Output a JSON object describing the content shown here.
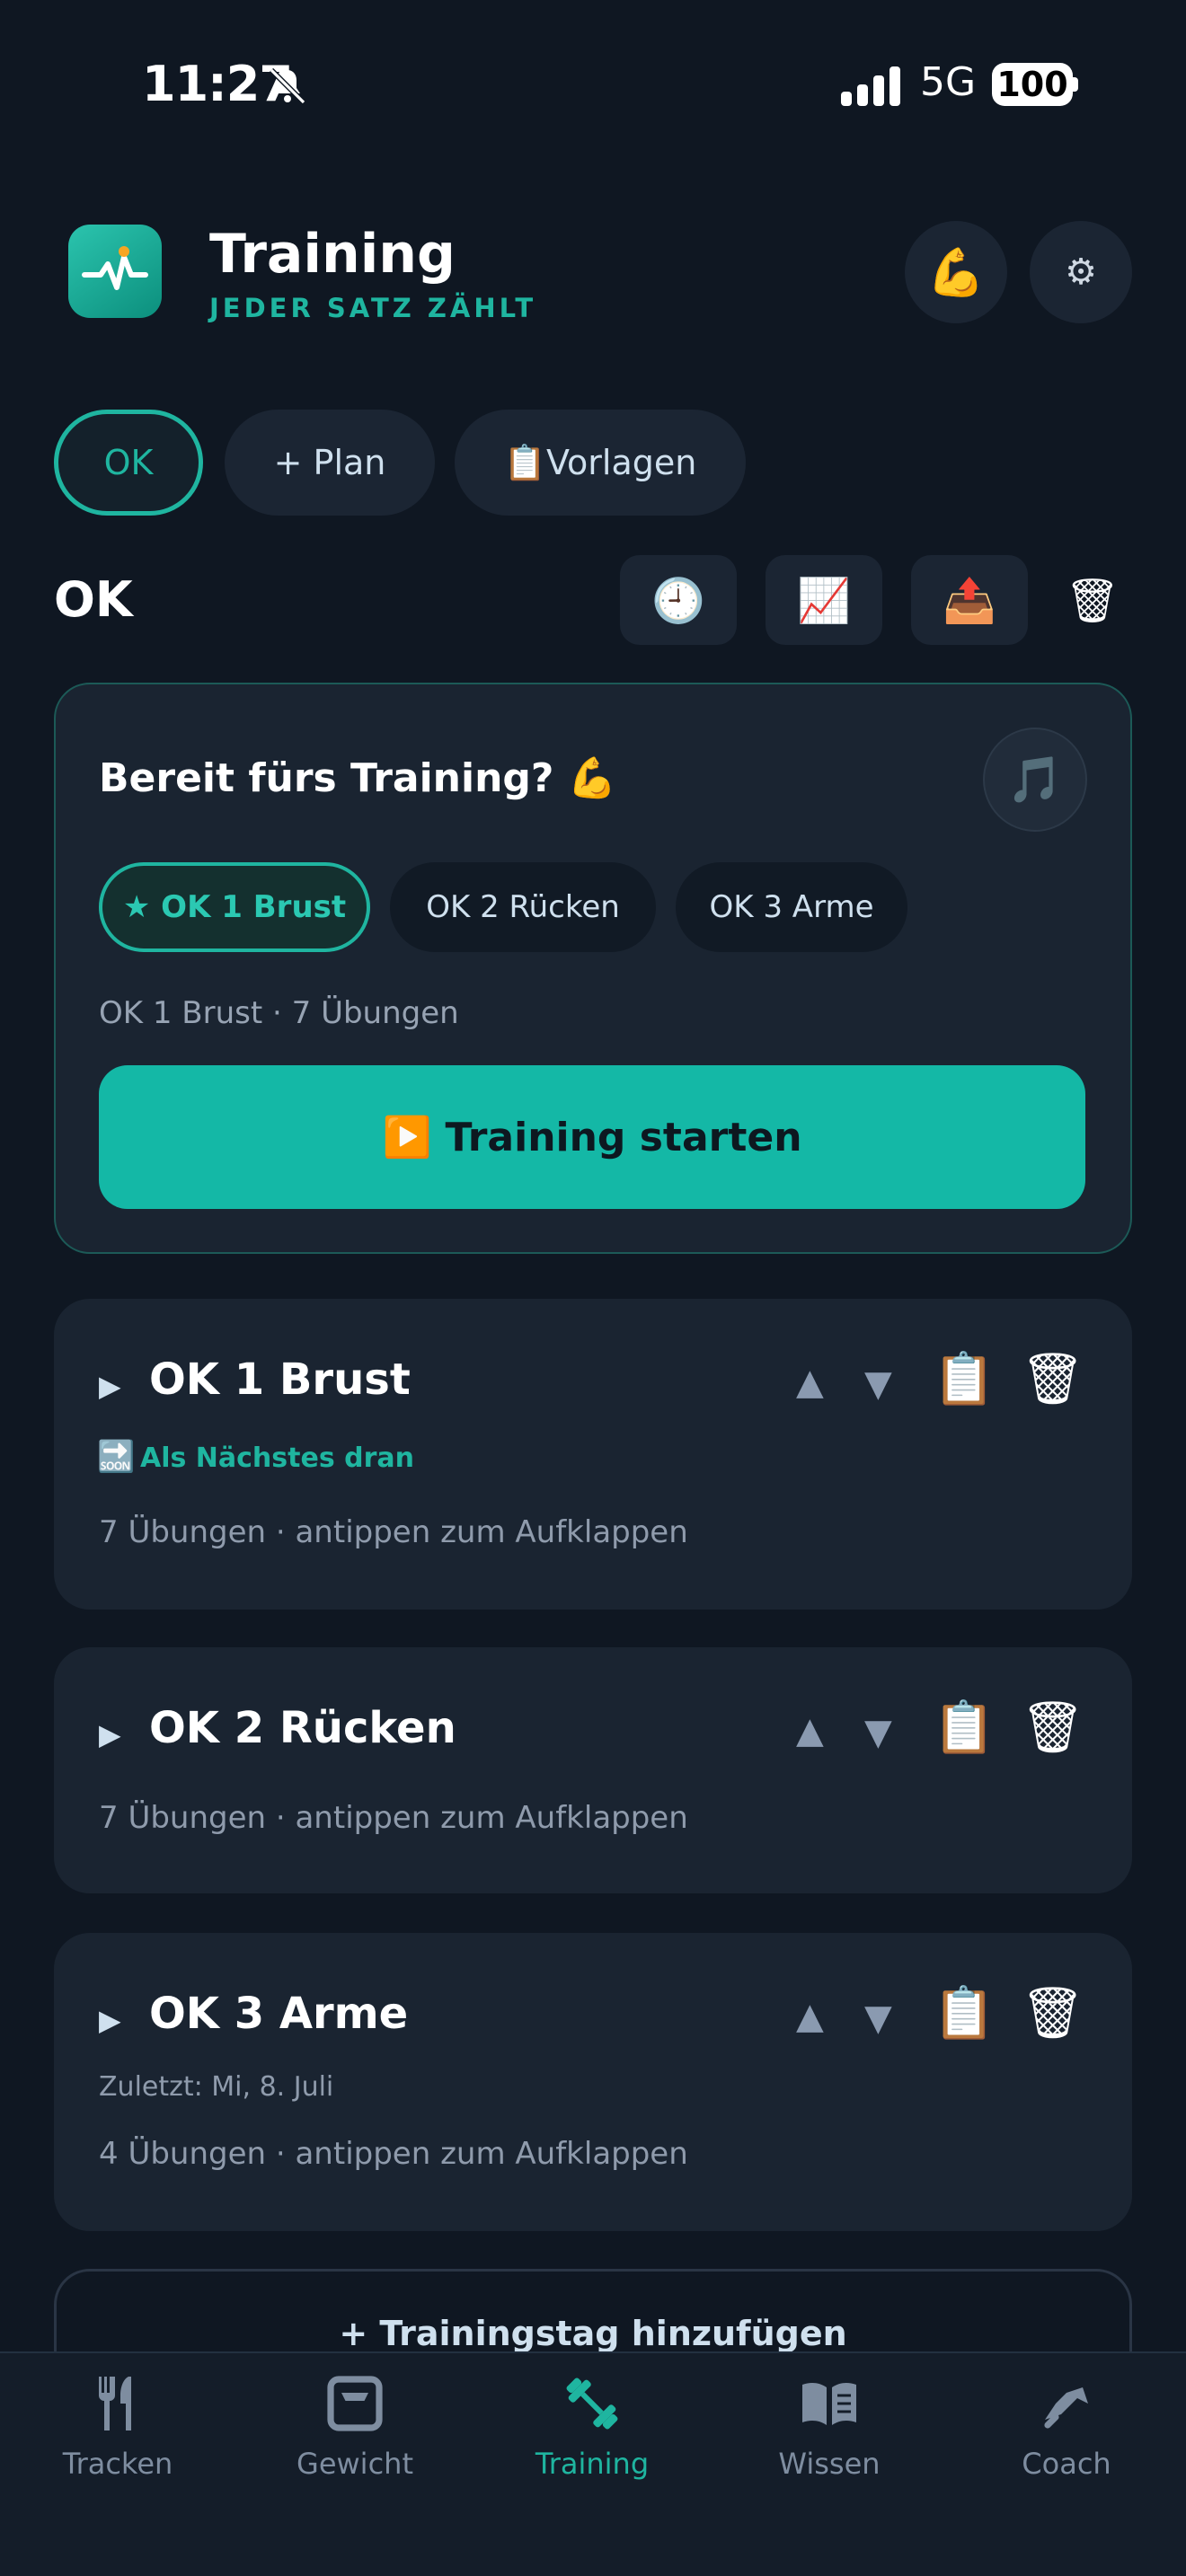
{
  "status_bar": {
    "time": "11:27",
    "network": "5G",
    "battery": "100"
  },
  "header": {
    "title": "Training",
    "subtitle": "JEDER SATZ ZÄHLT",
    "muscle_icon": "💪",
    "gear_icon": "⚙"
  },
  "plans": {
    "items": [
      {
        "label": "OK"
      },
      {
        "label": "+ Plan"
      },
      {
        "label": "📋Vorlagen"
      }
    ]
  },
  "section": {
    "title": "OK",
    "tools": [
      {
        "icon": "🕘"
      },
      {
        "icon": "📈"
      },
      {
        "icon": "📤"
      },
      {
        "icon": "🗑"
      }
    ]
  },
  "ready": {
    "title": "Bereit fürs Training? 💪",
    "music_icon": "🎵",
    "days": [
      {
        "label": "★ OK 1 Brust"
      },
      {
        "label": "OK 2 Rücken"
      },
      {
        "label": "OK 3 Arme"
      }
    ],
    "info": "OK 1 Brust · 7 Übungen",
    "start_label": "▶️ Training starten"
  },
  "days": [
    {
      "name": "OK 1 Brust",
      "badge": "Als Nächstes dran",
      "meta": "7 Übungen · antippen zum Aufklappen"
    },
    {
      "name": "OK 2 Rücken",
      "meta": "7 Übungen · antippen zum Aufklappen"
    },
    {
      "name": "OK 3 Arme",
      "last": "Zuletzt: Mi, 8. Juli",
      "meta": "4 Übungen · antippen zum Aufklappen"
    }
  ],
  "glyphs": {
    "caret": "▶",
    "up": "▲",
    "down": "▼",
    "clipboard": "📋",
    "trash": "🗑",
    "soon": "🔜"
  },
  "add_day": "+ Trainingstag hinzufügen",
  "nav": {
    "items": [
      {
        "label": "Tracken",
        "icon": "fork-knife-icon"
      },
      {
        "label": "Gewicht",
        "icon": "scale-icon"
      },
      {
        "label": "Training",
        "icon": "dumbbell-icon"
      },
      {
        "label": "Wissen",
        "icon": "book-icon"
      },
      {
        "label": "Coach",
        "icon": "coach-icon"
      }
    ],
    "active": "Training"
  },
  "colors": {
    "accent": "#1fb5a0",
    "background": "#0f1722",
    "card": "#1a2431",
    "start_button": "#14b8a6"
  }
}
